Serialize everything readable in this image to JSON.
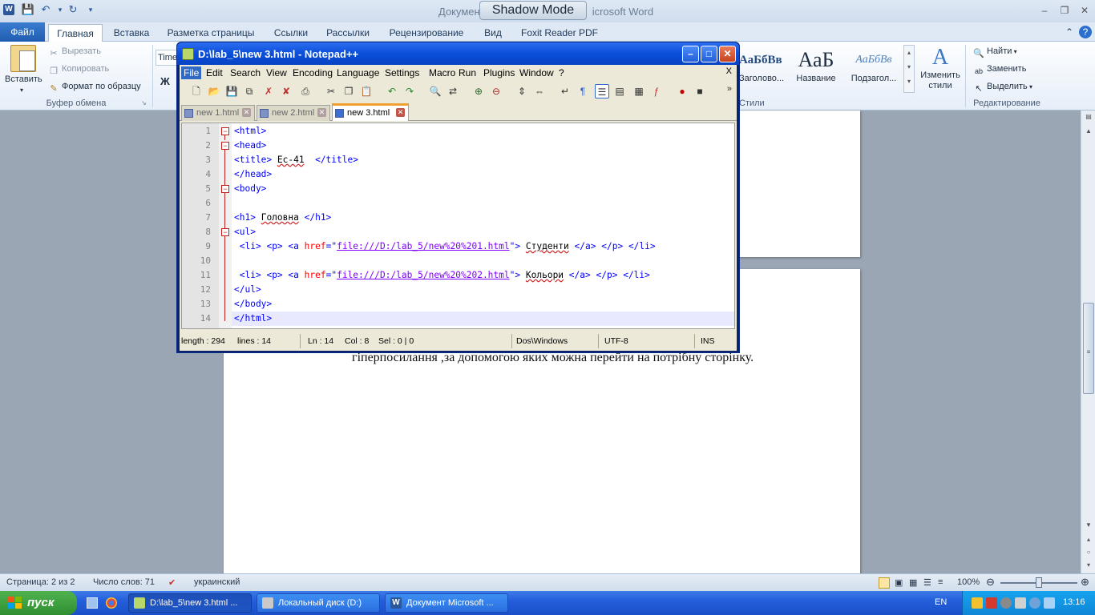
{
  "word": {
    "title_left": "Докумен",
    "title_right": "icrosoft Word",
    "shadow_mode": "Shadow Mode",
    "tabs": [
      {
        "label": "Файл"
      },
      {
        "label": "Главная"
      },
      {
        "label": "Вставка"
      },
      {
        "label": "Разметка страницы"
      },
      {
        "label": "Ссылки"
      },
      {
        "label": "Рассылки"
      },
      {
        "label": "Рецензирование"
      },
      {
        "label": "Вид"
      },
      {
        "label": "Foxit Reader PDF"
      }
    ],
    "ribbon": {
      "paste_label": "Вставить",
      "cut_label": "Вырезать",
      "copy_label": "Копировать",
      "format_painter_label": "Формат по образцу",
      "clipboard_group": "Буфер обмена",
      "font_name_partial": "Time",
      "bold_label": "Ж",
      "styles": [
        {
          "sample": "АаБбВв",
          "name": "Заголово..."
        },
        {
          "sample": "АаБ",
          "name": "Название"
        },
        {
          "sample": "АаБбВв",
          "name": "Подзагол..."
        }
      ],
      "change_styles_label": "Изменить стили",
      "styles_group": "Стили",
      "find_label": "Найти",
      "replace_label": "Заменить",
      "select_label": "Выделить",
      "editing_group": "Редактирование"
    },
    "document_text": "гіперпосилання ,за допомогою яких можна перейти на потрібну сторінку.",
    "status": {
      "page": "Страница: 2 из 2",
      "words": "Число слов: 71",
      "language": "украинский",
      "zoom": "100%"
    }
  },
  "npp": {
    "title": "D:\\lab_5\\new  3.html - Notepad++",
    "menu": [
      "File",
      "Edit",
      "Search",
      "View",
      "Encoding",
      "Language",
      "Settings",
      "Macro",
      "Run",
      "Plugins",
      "Window",
      "?"
    ],
    "menu_close": "X",
    "tabs": [
      {
        "label": "new  1.html",
        "active": false
      },
      {
        "label": "new  2.html",
        "active": false
      },
      {
        "label": "new  3.html",
        "active": true
      }
    ],
    "line_numbers": [
      "1",
      "2",
      "3",
      "4",
      "5",
      "6",
      "7",
      "8",
      "9",
      "10",
      "11",
      "12",
      "13",
      "14"
    ],
    "status": {
      "length": "length : 294",
      "lines": "lines : 14",
      "ln": "Ln : 14",
      "col": "Col : 8",
      "sel": "Sel : 0 | 0",
      "eol": "Dos\\Windows",
      "encoding": "UTF-8",
      "mode": "INS"
    }
  },
  "code": {
    "l1": "<html>",
    "l2": "<head>",
    "l3_open": "<title>",
    "l3_text": "Ec-41",
    "l3_close": "</title>",
    "l4": "</head>",
    "l5": "<body>",
    "l7_open": "<h1>",
    "l7_text": "Головна",
    "l7_close": "</h1>",
    "l8": "<ul>",
    "li_open": "<li>",
    "p_open": "<p>",
    "a_open": "<a",
    "href_attr": "href",
    "eq_quote": "=\"",
    "l9_href": "file:///D:/lab_5/new%20%201.html",
    "close_quote": "\"",
    "gt": ">",
    "l9_text": "Студенти",
    "a_close": "</a>",
    "p_close": "</p>",
    "li_close": "</li>",
    "l11_href": "file:///D:/lab_5/new%20%202.html",
    "l11_text": "Кольори",
    "l12": "</ul>",
    "l13": "</body>",
    "l14": "</html>"
  },
  "taskbar": {
    "start_label": "пуск",
    "items": [
      {
        "label": "D:\\lab_5\\new  3.html ..."
      },
      {
        "label": "Локальный диск (D:)"
      },
      {
        "label": "Документ Microsoft ..."
      }
    ],
    "language": "EN",
    "clock": "13:16"
  }
}
